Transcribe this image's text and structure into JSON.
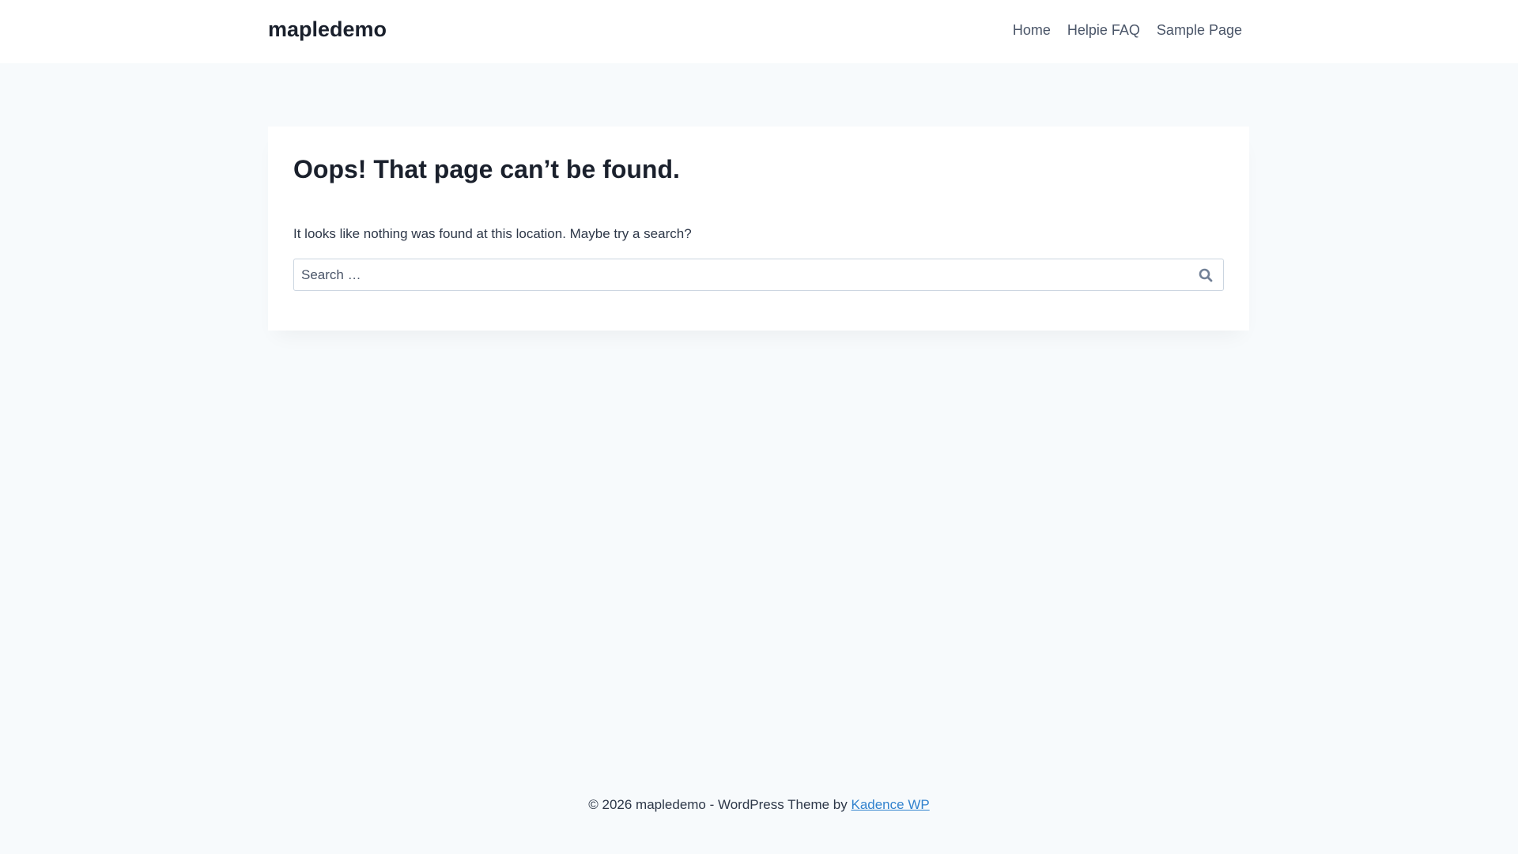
{
  "header": {
    "site_title": "mapledemo",
    "nav": [
      {
        "label": "Home"
      },
      {
        "label": "Helpie FAQ"
      },
      {
        "label": "Sample Page"
      }
    ]
  },
  "main": {
    "title": "Oops! That page can’t be found.",
    "message": "It looks like nothing was found at this location. Maybe try a search?",
    "search": {
      "placeholder": "Search …",
      "value": "",
      "icon": "search-icon"
    }
  },
  "footer": {
    "text": "© 2026 mapledemo - WordPress Theme by ",
    "link_label": "Kadence WP"
  },
  "colors": {
    "background": "#f7fafc",
    "link": "#3182ce",
    "nav": "#4a5568"
  }
}
